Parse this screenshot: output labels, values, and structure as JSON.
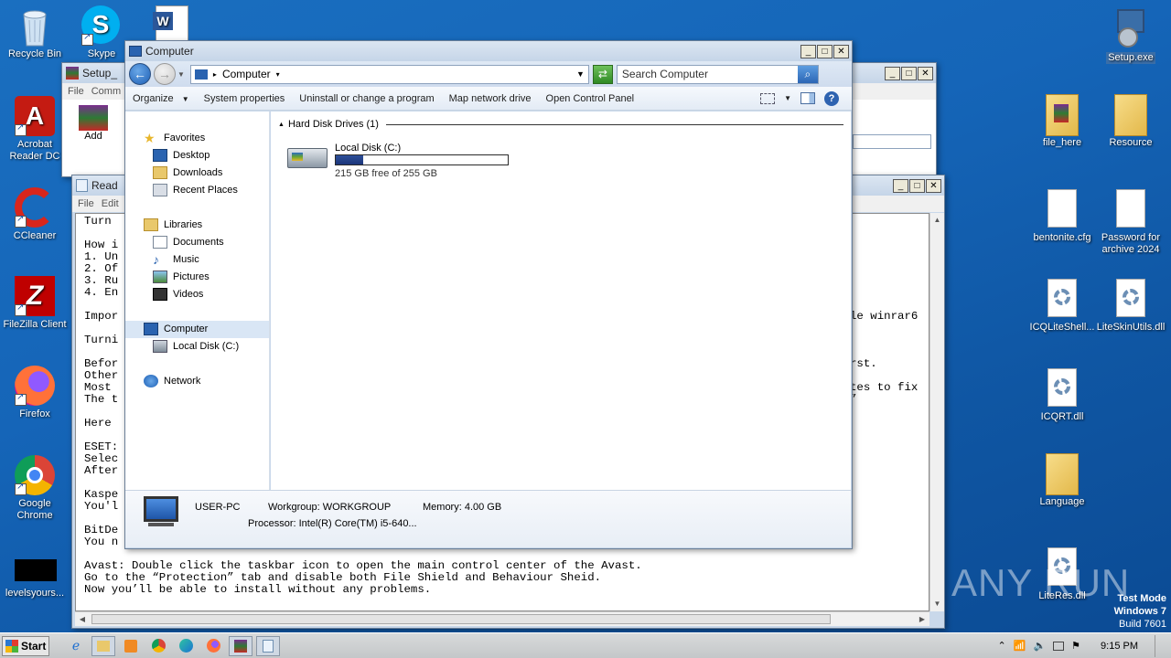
{
  "desktop": {
    "icons_left": [
      {
        "label": "Recycle Bin"
      },
      {
        "label": "Acrobat Reader DC"
      },
      {
        "label": "CCleaner"
      },
      {
        "label": "FileZilla Client"
      },
      {
        "label": "Firefox"
      },
      {
        "label": "Google Chrome"
      },
      {
        "label": "levelsyours..."
      }
    ],
    "icons_top": [
      {
        "label": "Skype"
      }
    ],
    "icons_right": [
      {
        "label": "Setup.exe"
      },
      {
        "label": "file_here"
      },
      {
        "label": "Resource"
      },
      {
        "label": "bentonite.cfg"
      },
      {
        "label": "Password for archive 2024"
      },
      {
        "label": "ICQLiteShell..."
      },
      {
        "label": "LiteSkinUtils.dll"
      },
      {
        "label": "ICQRT.dll"
      },
      {
        "label": "Language"
      },
      {
        "label": "LiteRes.dll"
      }
    ],
    "watermark": "ANY RUN",
    "testmode": {
      "line1": "Test Mode",
      "line2": "Windows 7",
      "line3": "Build 7601"
    }
  },
  "setup_window": {
    "title": "Setup_",
    "menu": [
      "File",
      "Comm"
    ],
    "add_label": "Add"
  },
  "notepad": {
    "title": "Read",
    "menu": [
      "File",
      "Edit"
    ],
    "lines_left": [
      "Turn ",
      "",
      "How i",
      "1. Un",
      "2. Of",
      "3. Ru",
      "4. En",
      "",
      "Impor",
      "",
      "Turni",
      "",
      "Befor",
      "Other",
      "Most ",
      "The t",
      "",
      "Here ",
      "",
      "ESET:",
      "Selec",
      "After",
      "",
      "Kaspe",
      "You'l",
      "",
      "BitDe",
      "You n"
    ],
    "right_fragments": [
      "le winrar6",
      "rst.",
      "tes to fix",
      "”"
    ],
    "bottom_lines": [
      "Avast: Double click the taskbar icon to open the main control center of the Avast.",
      "Go to the “Protection” tab and disable both File Shield and Behaviour Sheid.",
      "Now you’ll be able to install without any problems."
    ]
  },
  "explorer": {
    "title": "Computer",
    "address": "Computer",
    "search_placeholder": "Search Computer",
    "toolbar": {
      "organize": "Organize",
      "system_properties": "System properties",
      "uninstall": "Uninstall or change a program",
      "map_drive": "Map network drive",
      "control_panel": "Open Control Panel"
    },
    "nav": {
      "favorites": "Favorites",
      "desktop": "Desktop",
      "downloads": "Downloads",
      "recent": "Recent Places",
      "libraries": "Libraries",
      "documents": "Documents",
      "music": "Music",
      "pictures": "Pictures",
      "videos": "Videos",
      "computer": "Computer",
      "local_disk": "Local Disk (C:)",
      "network": "Network"
    },
    "group_header": "Hard Disk Drives (1)",
    "drive": {
      "name": "Local Disk (C:)",
      "free_text": "215 GB free of 255 GB",
      "used_fraction": 0.157
    },
    "details": {
      "pc_name": "USER-PC",
      "workgroup": "Workgroup: WORKGROUP",
      "memory": "Memory: 4.00 GB",
      "processor": "Processor: Intel(R) Core(TM) i5-640..."
    }
  },
  "taskbar": {
    "start": "Start",
    "time": "9:15 PM"
  }
}
